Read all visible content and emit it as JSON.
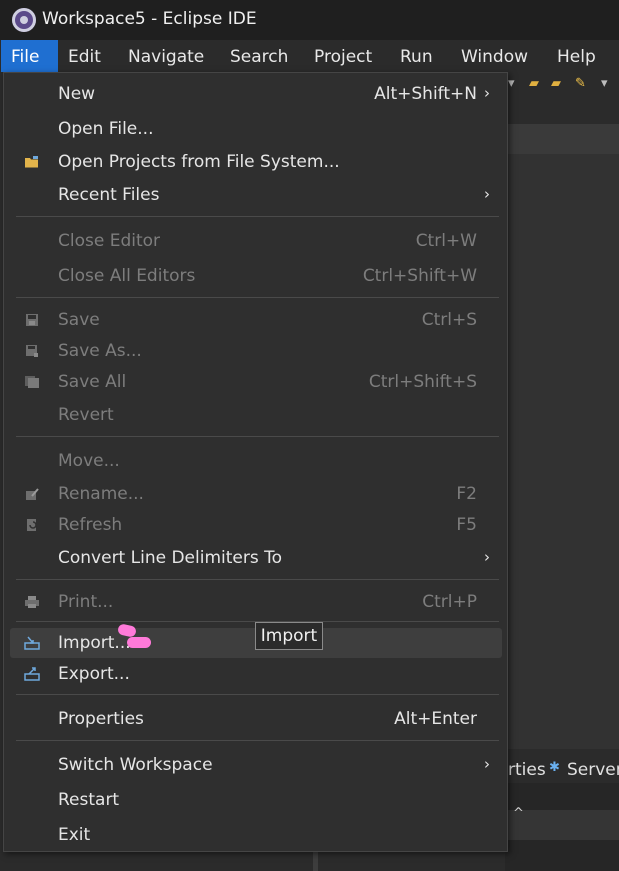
{
  "window": {
    "title": "Workspace5 - Eclipse IDE"
  },
  "menubar": [
    "File",
    "Edit",
    "Navigate",
    "Search",
    "Project",
    "Run",
    "Window",
    "Help"
  ],
  "file_menu": {
    "new": {
      "label": "New",
      "accel": "Alt+Shift+N"
    },
    "open_file": {
      "label": "Open File..."
    },
    "open_projects": {
      "label": "Open Projects from File System..."
    },
    "recent_files": {
      "label": "Recent Files"
    },
    "close_editor": {
      "label": "Close Editor",
      "accel": "Ctrl+W"
    },
    "close_all": {
      "label": "Close All Editors",
      "accel": "Ctrl+Shift+W"
    },
    "save": {
      "label": "Save",
      "accel": "Ctrl+S"
    },
    "save_as": {
      "label": "Save As..."
    },
    "save_all": {
      "label": "Save All",
      "accel": "Ctrl+Shift+S"
    },
    "revert": {
      "label": "Revert"
    },
    "move": {
      "label": "Move..."
    },
    "rename": {
      "label": "Rename...",
      "accel": "F2"
    },
    "refresh": {
      "label": "Refresh",
      "accel": "F5"
    },
    "convert": {
      "label": "Convert Line Delimiters To"
    },
    "print": {
      "label": "Print...",
      "accel": "Ctrl+P"
    },
    "import": {
      "label": "Import..."
    },
    "export": {
      "label": "Export..."
    },
    "properties": {
      "label": "Properties",
      "accel": "Alt+Enter"
    },
    "switch_ws": {
      "label": "Switch Workspace"
    },
    "restart": {
      "label": "Restart"
    },
    "exit": {
      "label": "Exit"
    }
  },
  "tooltip": {
    "text": "Import"
  },
  "background": {
    "panel_tab_partial": "rties",
    "servers_tab": "Servers"
  },
  "colors": {
    "accent": "#1f6fd1",
    "highlight": "#ff7ad9"
  }
}
